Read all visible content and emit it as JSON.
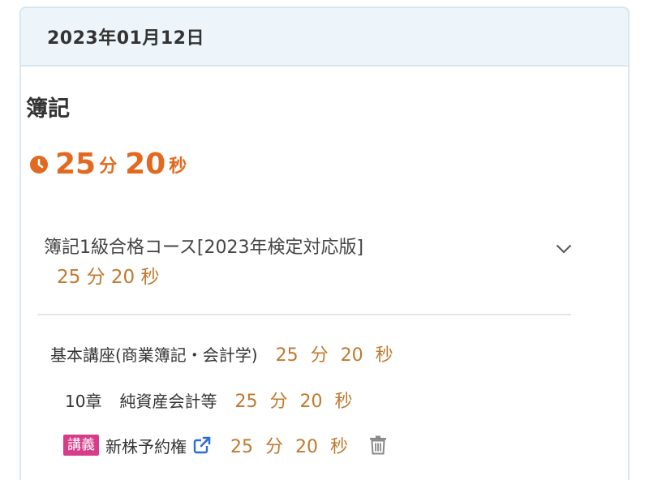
{
  "header": {
    "date": "2023年01月12日"
  },
  "subject": {
    "title": "簿記",
    "total": {
      "minutes": "25",
      "minutes_unit": "分",
      "seconds": "20",
      "seconds_unit": "秒"
    }
  },
  "course": {
    "name": "簿記1級合格コース[2023年検定対応版]",
    "time": {
      "minutes": "25",
      "minutes_unit": "分",
      "seconds": "20",
      "seconds_unit": "秒"
    }
  },
  "details": {
    "lecture_group": {
      "name": "基本講座(商業簿記・会計学)",
      "time": {
        "minutes": "25",
        "minutes_unit": "分",
        "seconds": "20",
        "seconds_unit": "秒"
      }
    },
    "chapter": {
      "number": "10章",
      "name": "純資産会計等",
      "time": {
        "minutes": "25",
        "minutes_unit": "分",
        "seconds": "20",
        "seconds_unit": "秒"
      }
    },
    "item": {
      "badge": "講義",
      "name": "新株予約権",
      "time": {
        "minutes": "25",
        "minutes_unit": "分",
        "seconds": "20",
        "seconds_unit": "秒"
      }
    }
  },
  "colors": {
    "accent_orange": "#e2691f",
    "time_brown": "#c0792e",
    "badge_pink": "#d63c8a",
    "link_blue": "#2c6fd1",
    "header_bg": "#eef5fa"
  },
  "icons": {
    "clock": "clock-icon",
    "chevron": "chevron-down-icon",
    "external": "external-link-icon",
    "trash": "trash-icon"
  }
}
